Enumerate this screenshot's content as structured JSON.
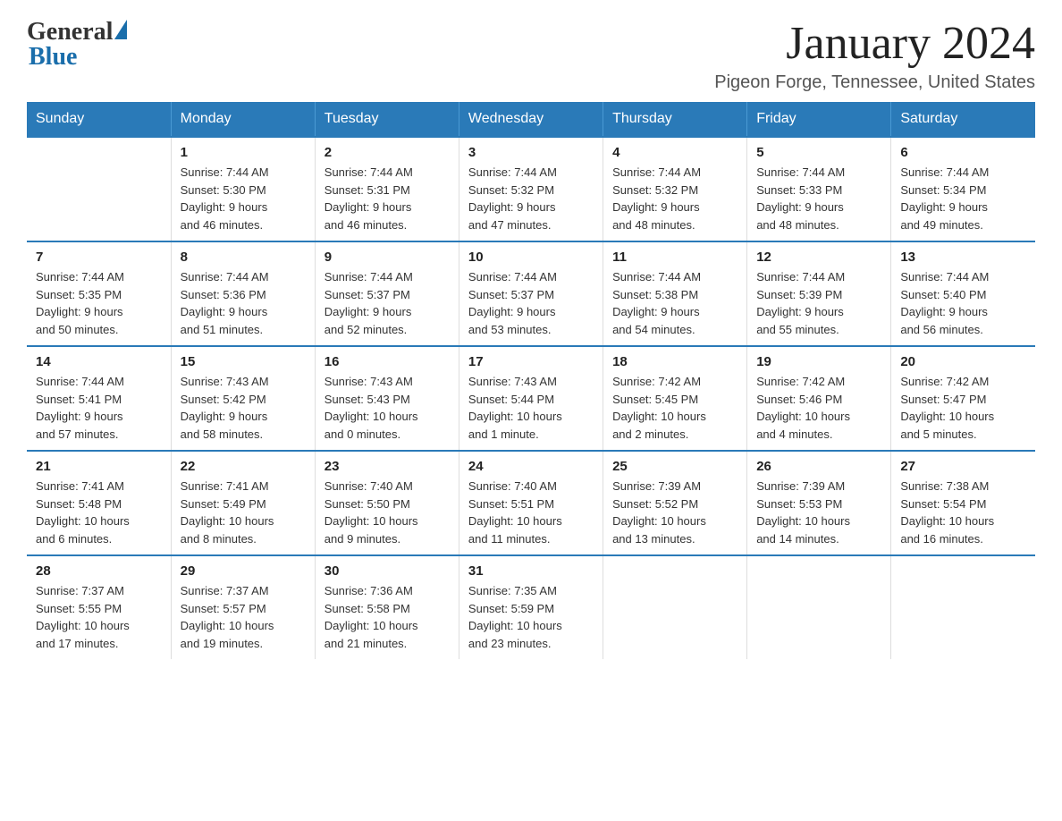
{
  "logo": {
    "general": "General",
    "blue": "Blue"
  },
  "header": {
    "month": "January 2024",
    "location": "Pigeon Forge, Tennessee, United States"
  },
  "weekdays": [
    "Sunday",
    "Monday",
    "Tuesday",
    "Wednesday",
    "Thursday",
    "Friday",
    "Saturday"
  ],
  "weeks": [
    [
      {
        "day": "",
        "info": ""
      },
      {
        "day": "1",
        "info": "Sunrise: 7:44 AM\nSunset: 5:30 PM\nDaylight: 9 hours\nand 46 minutes."
      },
      {
        "day": "2",
        "info": "Sunrise: 7:44 AM\nSunset: 5:31 PM\nDaylight: 9 hours\nand 46 minutes."
      },
      {
        "day": "3",
        "info": "Sunrise: 7:44 AM\nSunset: 5:32 PM\nDaylight: 9 hours\nand 47 minutes."
      },
      {
        "day": "4",
        "info": "Sunrise: 7:44 AM\nSunset: 5:32 PM\nDaylight: 9 hours\nand 48 minutes."
      },
      {
        "day": "5",
        "info": "Sunrise: 7:44 AM\nSunset: 5:33 PM\nDaylight: 9 hours\nand 48 minutes."
      },
      {
        "day": "6",
        "info": "Sunrise: 7:44 AM\nSunset: 5:34 PM\nDaylight: 9 hours\nand 49 minutes."
      }
    ],
    [
      {
        "day": "7",
        "info": "Sunrise: 7:44 AM\nSunset: 5:35 PM\nDaylight: 9 hours\nand 50 minutes."
      },
      {
        "day": "8",
        "info": "Sunrise: 7:44 AM\nSunset: 5:36 PM\nDaylight: 9 hours\nand 51 minutes."
      },
      {
        "day": "9",
        "info": "Sunrise: 7:44 AM\nSunset: 5:37 PM\nDaylight: 9 hours\nand 52 minutes."
      },
      {
        "day": "10",
        "info": "Sunrise: 7:44 AM\nSunset: 5:37 PM\nDaylight: 9 hours\nand 53 minutes."
      },
      {
        "day": "11",
        "info": "Sunrise: 7:44 AM\nSunset: 5:38 PM\nDaylight: 9 hours\nand 54 minutes."
      },
      {
        "day": "12",
        "info": "Sunrise: 7:44 AM\nSunset: 5:39 PM\nDaylight: 9 hours\nand 55 minutes."
      },
      {
        "day": "13",
        "info": "Sunrise: 7:44 AM\nSunset: 5:40 PM\nDaylight: 9 hours\nand 56 minutes."
      }
    ],
    [
      {
        "day": "14",
        "info": "Sunrise: 7:44 AM\nSunset: 5:41 PM\nDaylight: 9 hours\nand 57 minutes."
      },
      {
        "day": "15",
        "info": "Sunrise: 7:43 AM\nSunset: 5:42 PM\nDaylight: 9 hours\nand 58 minutes."
      },
      {
        "day": "16",
        "info": "Sunrise: 7:43 AM\nSunset: 5:43 PM\nDaylight: 10 hours\nand 0 minutes."
      },
      {
        "day": "17",
        "info": "Sunrise: 7:43 AM\nSunset: 5:44 PM\nDaylight: 10 hours\nand 1 minute."
      },
      {
        "day": "18",
        "info": "Sunrise: 7:42 AM\nSunset: 5:45 PM\nDaylight: 10 hours\nand 2 minutes."
      },
      {
        "day": "19",
        "info": "Sunrise: 7:42 AM\nSunset: 5:46 PM\nDaylight: 10 hours\nand 4 minutes."
      },
      {
        "day": "20",
        "info": "Sunrise: 7:42 AM\nSunset: 5:47 PM\nDaylight: 10 hours\nand 5 minutes."
      }
    ],
    [
      {
        "day": "21",
        "info": "Sunrise: 7:41 AM\nSunset: 5:48 PM\nDaylight: 10 hours\nand 6 minutes."
      },
      {
        "day": "22",
        "info": "Sunrise: 7:41 AM\nSunset: 5:49 PM\nDaylight: 10 hours\nand 8 minutes."
      },
      {
        "day": "23",
        "info": "Sunrise: 7:40 AM\nSunset: 5:50 PM\nDaylight: 10 hours\nand 9 minutes."
      },
      {
        "day": "24",
        "info": "Sunrise: 7:40 AM\nSunset: 5:51 PM\nDaylight: 10 hours\nand 11 minutes."
      },
      {
        "day": "25",
        "info": "Sunrise: 7:39 AM\nSunset: 5:52 PM\nDaylight: 10 hours\nand 13 minutes."
      },
      {
        "day": "26",
        "info": "Sunrise: 7:39 AM\nSunset: 5:53 PM\nDaylight: 10 hours\nand 14 minutes."
      },
      {
        "day": "27",
        "info": "Sunrise: 7:38 AM\nSunset: 5:54 PM\nDaylight: 10 hours\nand 16 minutes."
      }
    ],
    [
      {
        "day": "28",
        "info": "Sunrise: 7:37 AM\nSunset: 5:55 PM\nDaylight: 10 hours\nand 17 minutes."
      },
      {
        "day": "29",
        "info": "Sunrise: 7:37 AM\nSunset: 5:57 PM\nDaylight: 10 hours\nand 19 minutes."
      },
      {
        "day": "30",
        "info": "Sunrise: 7:36 AM\nSunset: 5:58 PM\nDaylight: 10 hours\nand 21 minutes."
      },
      {
        "day": "31",
        "info": "Sunrise: 7:35 AM\nSunset: 5:59 PM\nDaylight: 10 hours\nand 23 minutes."
      },
      {
        "day": "",
        "info": ""
      },
      {
        "day": "",
        "info": ""
      },
      {
        "day": "",
        "info": ""
      }
    ]
  ]
}
